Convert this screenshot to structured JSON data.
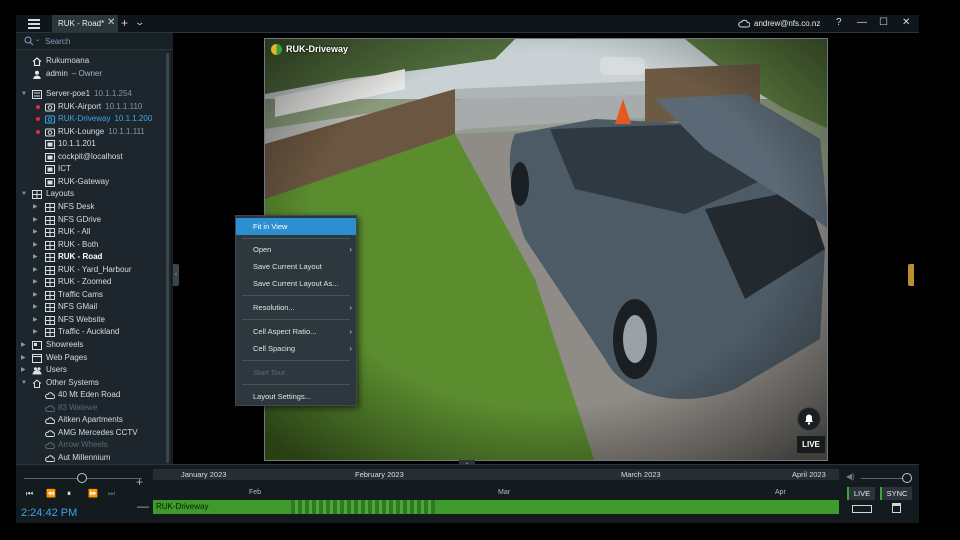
{
  "titlebar": {
    "tab_label": "RUK - Road*",
    "tab_close": "✕",
    "tab_add": "+",
    "tab_list": "⌄",
    "user_email": "andrew@nfs.co.nz",
    "help": "?",
    "minimize": "—",
    "maximize": "☐",
    "close": "✕"
  },
  "search": {
    "placeholder": "Search"
  },
  "tree": {
    "site": "Rukumoana",
    "user": "admin",
    "user_role": "Owner",
    "server": {
      "label": "Server-poe1",
      "ip": "10.1.1.254"
    },
    "cameras": [
      {
        "label": "RUK-Airport",
        "ip": "10.1.1.110"
      },
      {
        "label": "RUK-Driveway",
        "ip": "10.1.1.200"
      },
      {
        "label": "RUK-Lounge",
        "ip": "10.1.1.111"
      }
    ],
    "other_devices": [
      "10.1.1.201",
      "cockpit@localhost",
      "ICT",
      "RUK-Gateway"
    ],
    "layouts_label": "Layouts",
    "layouts": [
      "NFS Desk",
      "NFS GDrive",
      "RUK - All",
      "RUK - Both",
      "RUK - Road",
      "RUK - Yard_Harbour",
      "RUK - Zoomed",
      "Traffic Cams",
      "NFS GMail",
      "NFS Website",
      "Traffic - Auckland"
    ],
    "showreels": "Showreels",
    "web_pages": "Web Pages",
    "users": "Users",
    "other_systems": "Other Systems",
    "systems": [
      {
        "label": "40 Mt Eden Road",
        "online": true
      },
      {
        "label": "83 Walewe",
        "online": false
      },
      {
        "label": "Aitken Apartments",
        "online": true
      },
      {
        "label": "AMG Mercedes CCTV",
        "online": true
      },
      {
        "label": "Arrow Wheels",
        "online": false
      },
      {
        "label": "Aut Millennium",
        "online": true
      }
    ]
  },
  "camera": {
    "name": "RUK-Driveway",
    "live": "LIVE"
  },
  "context_menu": {
    "fit_in_view": "Fit in View",
    "open": "Open",
    "save_layout": "Save Current Layout",
    "save_layout_as": "Save Current Layout As...",
    "resolution": "Resolution...",
    "cell_aspect": "Cell Aspect Ratio...",
    "cell_spacing": "Cell Spacing",
    "start_tour": "Start Tour",
    "layout_settings": "Layout Settings...",
    "chevron": "›"
  },
  "timeline": {
    "months": [
      "January 2023",
      "February 2023",
      "March 2023",
      "April 2023"
    ],
    "ticks": [
      "Feb",
      "Mar",
      "Apr"
    ],
    "track_label": "RUK-Driveway",
    "clock": "2:24:42 PM",
    "zoom_in": "+",
    "zoom_out": "—",
    "live_btn": "LIVE",
    "sync_btn": "SYNC",
    "playback": {
      "skip_back": "⏮",
      "rewind": "⏪",
      "pause": "⏸",
      "forward": "⏩",
      "skip_forward": "⏭"
    }
  },
  "colors": {
    "accent": "#3aa6e6",
    "track": "#3f9a2c",
    "alert": "#e8293a",
    "menu_highlight": "#2c8fd0"
  }
}
